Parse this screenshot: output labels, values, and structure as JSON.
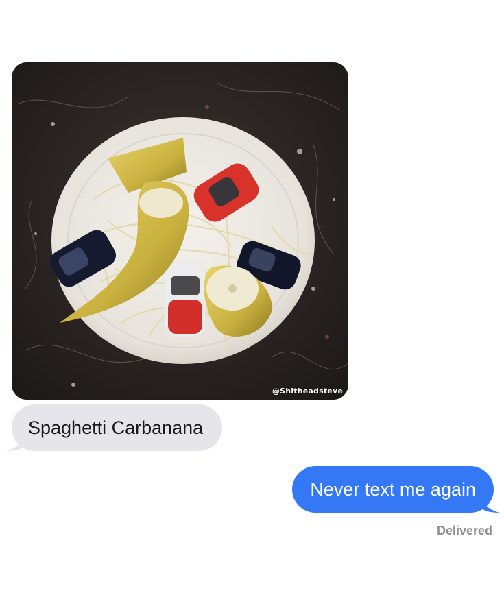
{
  "conversation": {
    "photo": {
      "subject": "plate of spaghetti with bananas and toy cars",
      "watermark": "@Shitheadsteve"
    },
    "messages": [
      {
        "direction": "received",
        "text": "Spaghetti Carbanana"
      },
      {
        "direction": "sent",
        "text": "Never text me again"
      }
    ],
    "status": "Delivered"
  },
  "colors": {
    "sent_bubble": "#3478f6",
    "received_bubble": "#e6e5ea",
    "status_text": "#8e8e93",
    "background": "#ffffff"
  }
}
